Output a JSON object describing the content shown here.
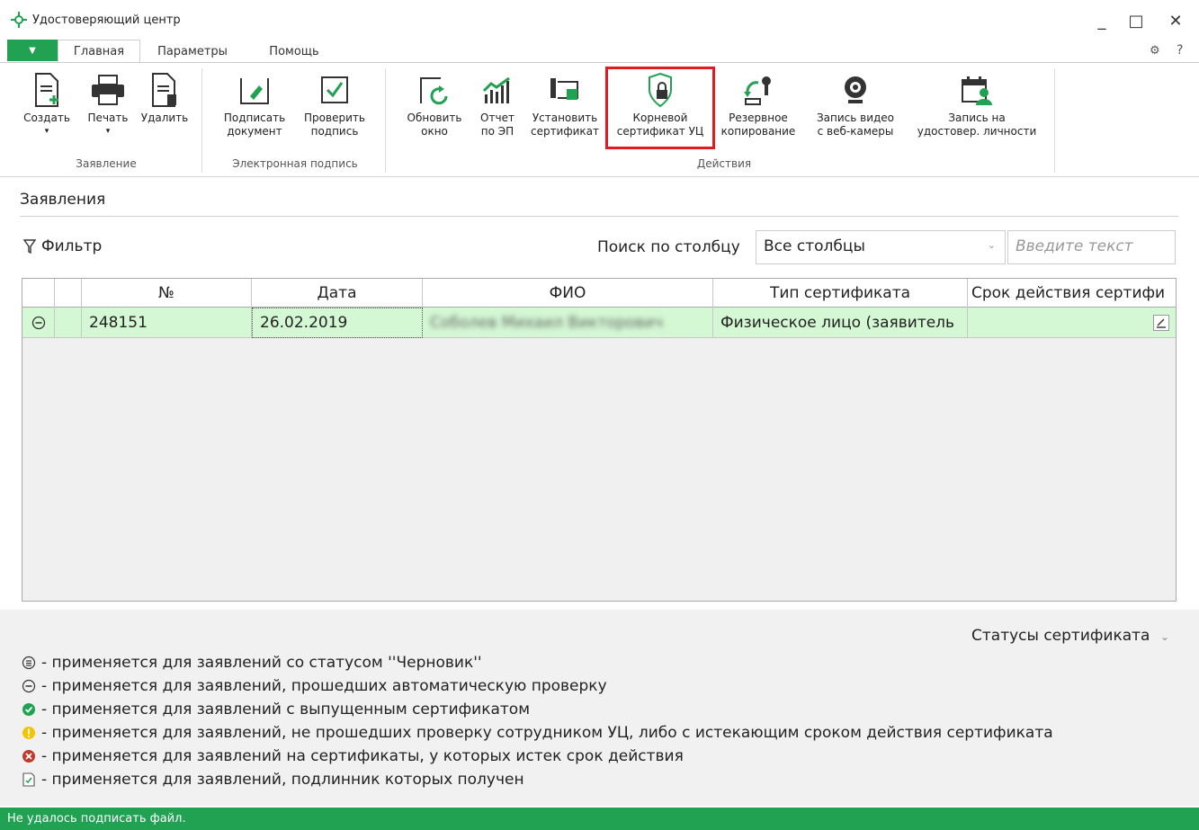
{
  "window": {
    "title": "Удостоверяющий центр",
    "min_glyph": "_",
    "max_glyph": "□",
    "close_glyph": "✕"
  },
  "ribbon_tabs": {
    "menu_glyph": "▼",
    "tabs": [
      {
        "label": "Главная",
        "active": true
      },
      {
        "label": "Параметры",
        "active": false
      },
      {
        "label": "Помощь",
        "active": false
      }
    ],
    "help_glyph": "?"
  },
  "ribbon": {
    "groups": [
      {
        "label": "Заявление"
      },
      {
        "label": "Электронная подпись"
      },
      {
        "label": "Действия"
      }
    ],
    "buttons": {
      "create": {
        "line1": "Создать",
        "line2": "▾",
        "icon": "new-document-icon"
      },
      "print": {
        "line1": "Печать",
        "line2": "▾",
        "icon": "printer-icon"
      },
      "delete": {
        "line1": "Удалить",
        "line2": "",
        "icon": "delete-document-icon"
      },
      "sign": {
        "line1": "Подписать",
        "line2": "документ",
        "icon": "sign-document-icon"
      },
      "verify": {
        "line1": "Проверить",
        "line2": "подпись",
        "icon": "checkbox-icon"
      },
      "refresh": {
        "line1": "Обновить",
        "line2": "окно",
        "icon": "refresh-window-icon"
      },
      "report": {
        "line1": "Отчет",
        "line2": "по ЭП",
        "icon": "chart-icon"
      },
      "install": {
        "line1": "Установить",
        "line2": "сертификат",
        "icon": "install-certificate-icon"
      },
      "root_cert": {
        "line1": "Корневой",
        "line2": "сертификат УЦ",
        "icon": "shield-lock-icon"
      },
      "backup": {
        "line1": "Резервное",
        "line2": "копирование",
        "icon": "backup-key-icon"
      },
      "webcam": {
        "line1": "Запись видео",
        "line2": "с веб-камеры",
        "icon": "webcam-icon"
      },
      "id_record": {
        "line1": "Запись на",
        "line2": "удостовер. личности",
        "icon": "calendar-person-icon"
      }
    },
    "accent": "#21a152",
    "highlight_color": "#e21b23"
  },
  "section": {
    "title": "Заявления"
  },
  "toolbar": {
    "filter_label": "Фильтр",
    "search_label": "Поиск по столбцу",
    "column_select_value": "Все столбцы",
    "search_placeholder": "Введите текст"
  },
  "grid": {
    "columns": [
      "",
      "",
      "№",
      "Дата",
      "ФИО",
      "Тип сертификата",
      "Срок действия сертифи"
    ],
    "rows": [
      {
        "status_icon": "auto-check-passed-icon",
        "number": "248151",
        "date": "26.02.2019",
        "fio": "Соболев Михаил Викторович",
        "cert_type": "Физическое лицо (заявитель",
        "validity": ""
      }
    ],
    "row_color": "#d4f7d4"
  },
  "legend": {
    "toggle_label": "Статусы сертификата",
    "items": [
      {
        "icon": "draft-status-icon",
        "text": "- применяется для заявлений со статусом ''Черновик''"
      },
      {
        "icon": "auto-check-status-icon",
        "text": "- применяется для заявлений, прошедших автоматическую проверку"
      },
      {
        "icon": "issued-status-icon",
        "text": "- применяется для заявлений с выпущенным сертификатом"
      },
      {
        "icon": "warning-status-icon",
        "text": "- применяется для заявлений, не прошедших проверку сотрудником УЦ, либо с истекающим сроком действия сертификата"
      },
      {
        "icon": "expired-status-icon",
        "text": "- применяется для заявлений на сертификаты, у которых истек срок действия"
      },
      {
        "icon": "original-received-icon",
        "text": "- применяется для заявлений, подлинник которых получен"
      }
    ]
  },
  "statusbar": {
    "text": "Не удалось подписать файл."
  }
}
